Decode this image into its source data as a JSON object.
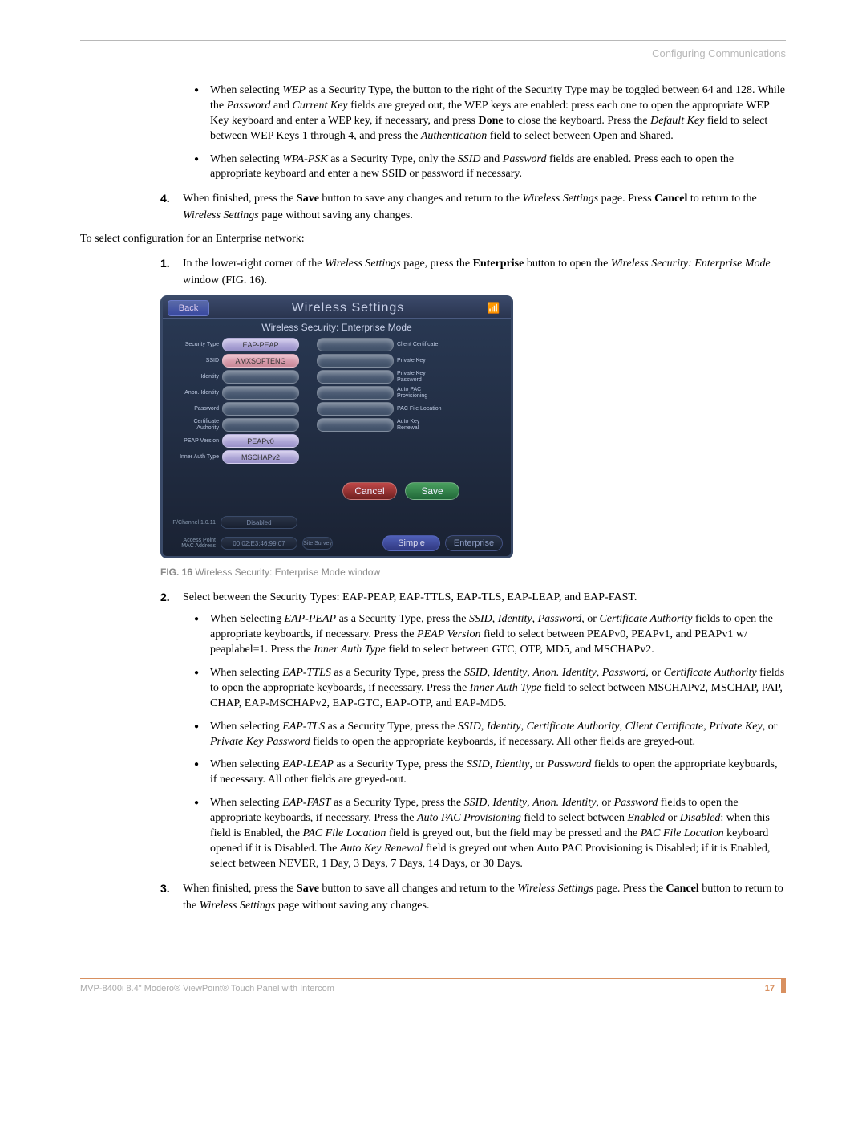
{
  "header": {
    "section": "Configuring Communications"
  },
  "bullets_top": [
    {
      "prefix": "When selecting ",
      "em1": "WEP",
      "mid1": " as a Security Type, the button to the right of the Security Type may be toggled between 64 and 128. While the ",
      "em2": "Password",
      "mid2": " and ",
      "em3": "Current Key",
      "mid3": " fields are greyed out, the WEP keys are enabled: press each one to open the appropriate WEP Key keyboard and enter a WEP key, if necessary, and press ",
      "b1": "Done",
      "mid4": " to close the keyboard. Press the ",
      "em4": "Default Key",
      "mid5": " field to select between WEP Keys 1 through 4, and press the ",
      "em5": "Authentication",
      "tail": " field to select between Open and Shared."
    },
    {
      "prefix": "When selecting ",
      "em1": "WPA-PSK",
      "mid1": " as a Security Type, only the ",
      "em2": "SSID",
      "mid2": " and ",
      "em3": "Password",
      "tail": " fields are enabled. Press each to open the appropriate keyboard and enter a new SSID or password if necessary."
    }
  ],
  "steps_top": {
    "four": {
      "num": "4.",
      "t1": "When finished, press the ",
      "b1": "Save",
      "t2": " button to save any changes and return to the ",
      "em1": "Wireless Settings",
      "t3": " page. Press ",
      "b2": "Cancel",
      "t4": " to return to the ",
      "em2": "Wireless Settings",
      "t5": " page without saving any changes."
    }
  },
  "intro": "To select configuration for an Enterprise network:",
  "steps_mid": {
    "one": {
      "num": "1.",
      "t1": "In the lower-right corner of the ",
      "em1": "Wireless Settings",
      "t2": " page, press the ",
      "b1": "Enterprise",
      "t3": " button to open the ",
      "em2": "Wireless Security: Enterprise Mode",
      "t4": " window (FIG. 16)."
    }
  },
  "panel": {
    "back": "Back",
    "title": "Wireless Settings",
    "subtitle": "Wireless Security: Enterprise Mode",
    "rows": [
      {
        "ll": "Security Type",
        "lv": "EAP-PEAP",
        "lc": "pill-lav",
        "rv": "",
        "rl": "Client Certificate"
      },
      {
        "ll": "SSID",
        "lv": "AMXSOFTENG",
        "lc": "pill-pink",
        "rv": "",
        "rl": "Private Key"
      },
      {
        "ll": "Identity",
        "lv": "",
        "lc": "pill-grey",
        "rv": "",
        "rl": "Private Key Password"
      },
      {
        "ll": "Anon. Identity",
        "lv": "",
        "lc": "pill-grey",
        "rv": "",
        "rl": "Auto PAC Provisioning"
      },
      {
        "ll": "Password",
        "lv": "",
        "lc": "pill-grey",
        "rv": "",
        "rl": "PAC File Location"
      },
      {
        "ll": "Certificate Authority",
        "lv": "",
        "lc": "pill-grey",
        "rv": "",
        "rl": "Auto Key Renewal"
      },
      {
        "ll": "PEAP Version",
        "lv": "PEAPv0",
        "lc": "pill-lav",
        "rv": "",
        "rl": ""
      },
      {
        "ll": "Inner Auth Type",
        "lv": "MSCHAPv2",
        "lc": "pill-lav",
        "rv": "",
        "rl": ""
      }
    ],
    "cancel": "Cancel",
    "save": "Save",
    "bottom1": {
      "label": "IP/Channel 1.0.11",
      "value": "Disabled"
    },
    "bottom2": {
      "label": "Access Point MAC Address",
      "value": "00:02:E3:46:99:07",
      "site": "Site Survey"
    },
    "mode_simple": "Simple",
    "mode_enterprise": "Enterprise"
  },
  "fig": {
    "label": "FIG. 16",
    "caption": "  Wireless Security: Enterprise Mode window"
  },
  "steps_bot": {
    "two": {
      "num": "2.",
      "text": "Select between the Security Types: EAP-PEAP, EAP-TTLS, EAP-TLS, EAP-LEAP, and EAP-FAST."
    },
    "three": {
      "num": "3.",
      "t1": "When finished, press the ",
      "b1": "Save",
      "t2": " button to save all changes and return to the ",
      "em1": "Wireless Settings",
      "t3": " page. Press the ",
      "b2": "Cancel",
      "t4": " button to return to the ",
      "em2": "Wireless Settings",
      "t5": " page without saving any changes."
    }
  },
  "bullets_bot": [
    {
      "t0": "When Selecting ",
      "e1": "EAP-PEAP",
      "t1": " as a Security Type, press the ",
      "e2": "SSID",
      "t2": ", ",
      "e3": "Identity",
      "t3": ", ",
      "e4": "Password",
      "t4": ", or ",
      "e5": "Certificate Authority",
      "t5": " fields to open the appropriate keyboards, if necessary. Press the ",
      "e6": "PEAP Version",
      "t6": " field to select between PEAPv0, PEAPv1, and PEAPv1 w/ peaplabel=1. Press the ",
      "e7": "Inner Auth Type",
      "t7": " field to select between GTC, OTP, MD5, and MSCHAPv2."
    },
    {
      "t0": "When selecting ",
      "e1": "EAP-TTLS",
      "t1": " as a Security Type, press the ",
      "e2": "SSID",
      "t2": ", ",
      "e3": "Identity",
      "t3": ", ",
      "e4": "Anon. Identity",
      "t4": ", ",
      "e5": "Password",
      "t5": ", or ",
      "e6": "Certificate Authority",
      "t6": " fields to open the appropriate keyboards, if necessary. Press the ",
      "e7": "Inner Auth Type",
      "t7": " field to select between MSCHAPv2, MSCHAP, PAP, CHAP, EAP-MSCHAPv2, EAP-GTC, EAP-OTP, and EAP-MD5."
    },
    {
      "t0": "When selecting ",
      "e1": "EAP-TLS",
      "t1": " as a Security Type, press the ",
      "e2": "SSID",
      "t2": ", ",
      "e3": "Identity",
      "t3": ", ",
      "e4": "Certificate Authority",
      "t4": ", ",
      "e5": "Client Certificate",
      "t5": ", ",
      "e6": "Private Key",
      "t6": ", or ",
      "e7": "Private Key Password",
      "t7": " fields to open the appropriate keyboards, if necessary. All other fields are greyed-out."
    },
    {
      "t0": "When selecting ",
      "e1": "EAP-LEAP",
      "t1": " as a Security Type, press the ",
      "e2": "SSID",
      "t2": ", ",
      "e3": "Identity",
      "t3": ", or ",
      "e4": "Password",
      "t4": " fields to open the appropriate keyboards, if necessary. All other fields are greyed-out."
    },
    {
      "t0": "When selecting ",
      "e1": "EAP-FAST",
      "t1": " as a Security Type, press the ",
      "e2": "SSID",
      "t2": ", ",
      "e3": "Identity",
      "t3": ", ",
      "e4": "Anon. Identity",
      "t4": ", or ",
      "e5": "Password",
      "t5": " fields to open the appropriate keyboards, if necessary. Press the ",
      "e6": "Auto PAC Provisioning",
      "t6": " field to select between ",
      "e7": "Enabled",
      "t7": " or ",
      "e8": "Disabled",
      "t8": ": when this field is Enabled, the ",
      "e9": "PAC File Location",
      "t9": " field is greyed out, but the field may be pressed and the ",
      "e10": "PAC File Location",
      "t10": " keyboard opened if it is Disabled. The ",
      "e11": "Auto Key Renewal",
      "t11": " field is greyed out when Auto PAC Provisioning is Disabled; if it is Enabled, select between NEVER, 1 Day, 3 Days, 7 Days, 14 Days, or 30 Days."
    }
  ],
  "footer": {
    "product": "MVP-8400i 8.4\" Modero® ViewPoint® Touch Panel with Intercom",
    "page": "17"
  }
}
